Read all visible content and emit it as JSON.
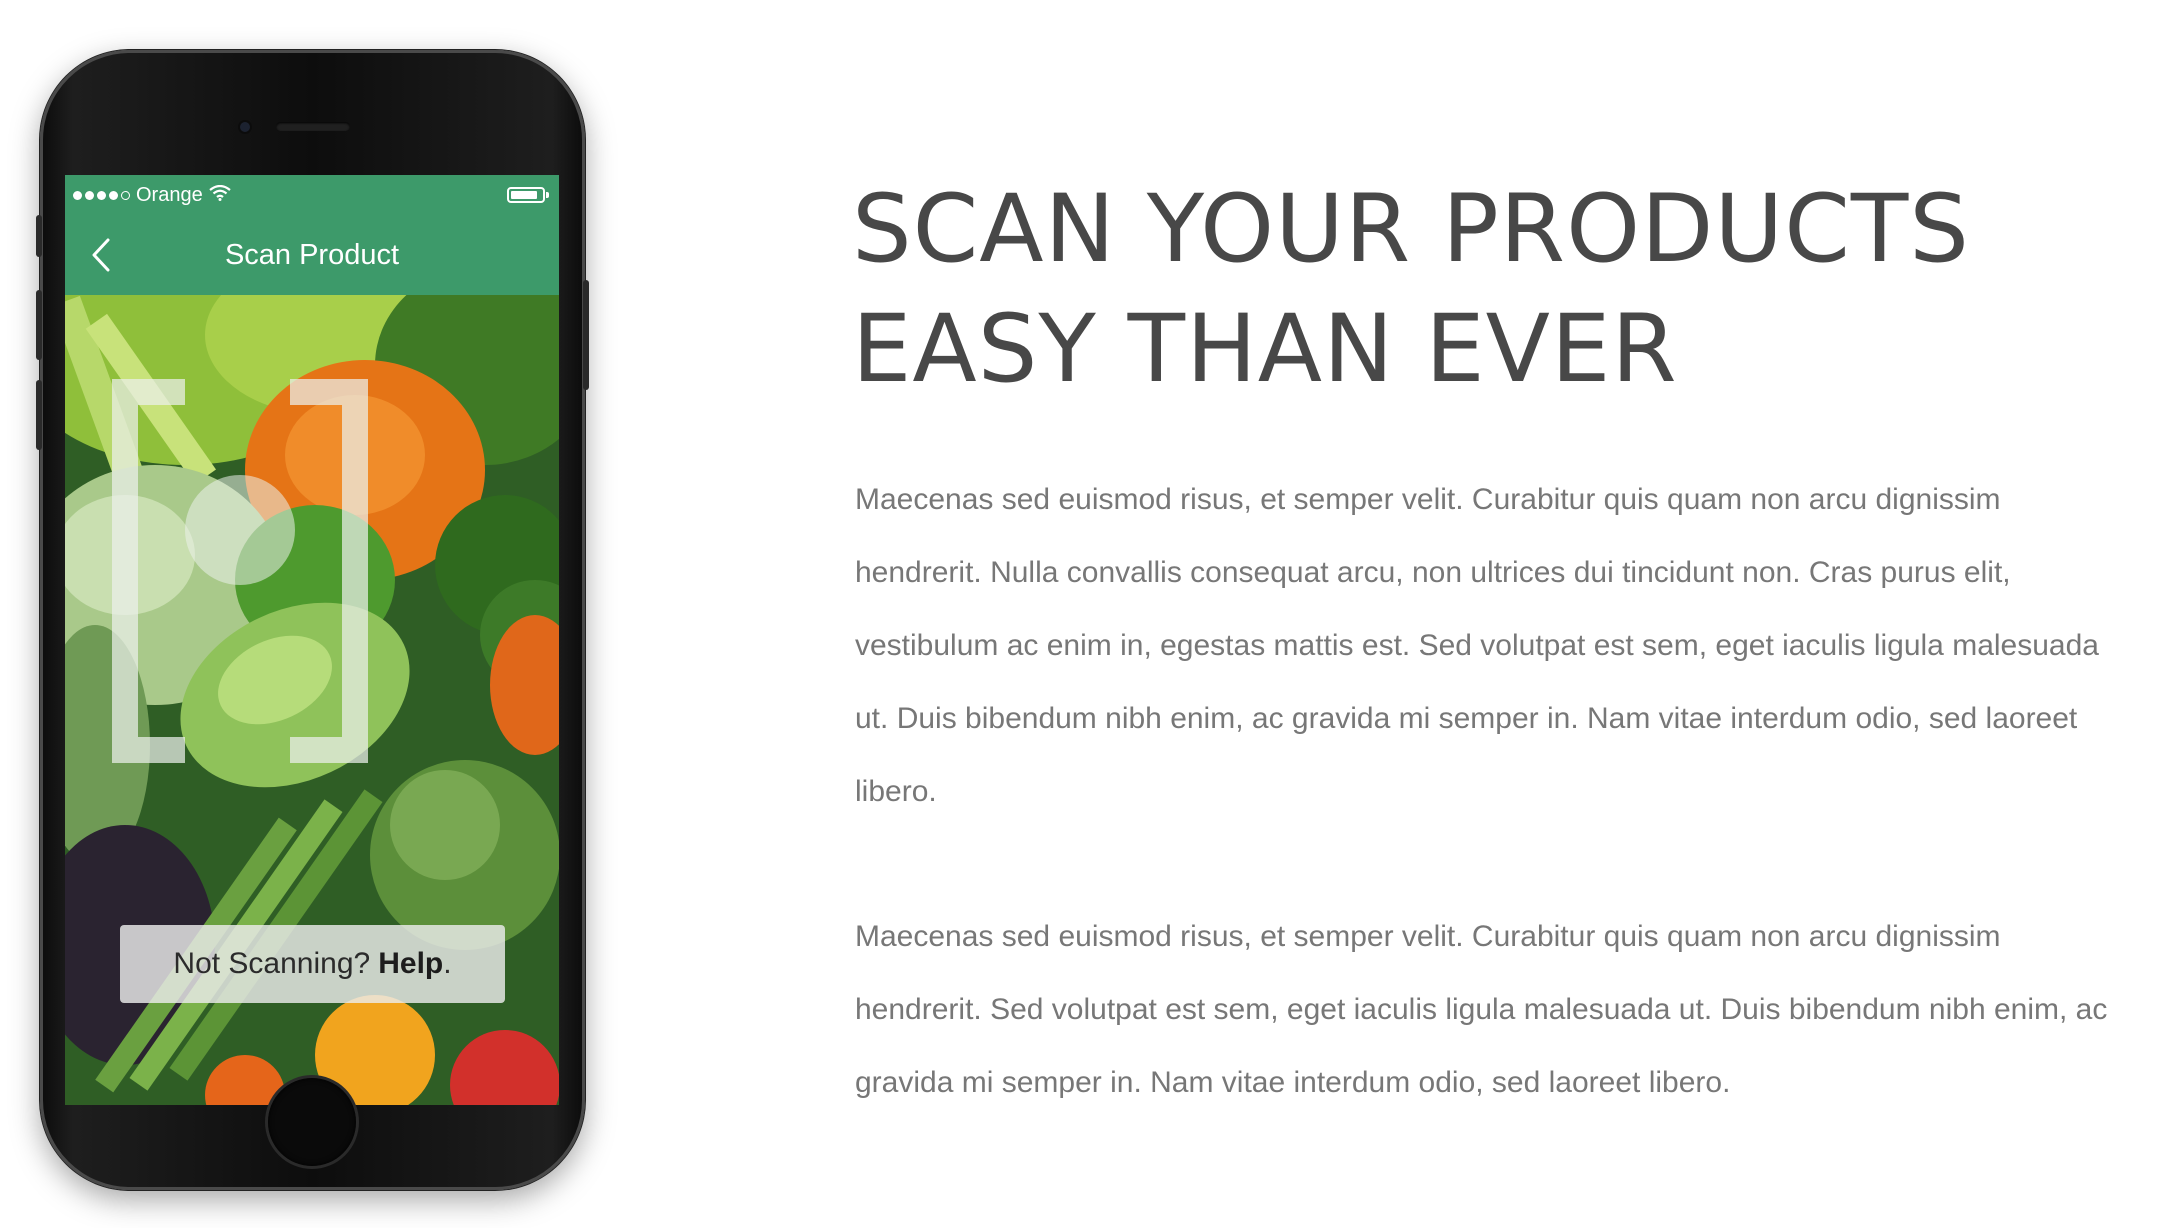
{
  "phone": {
    "status_bar": {
      "carrier": "Orange",
      "signal_bars_filled": 4,
      "signal_bars_total": 5,
      "icons": [
        "signal-dots-icon",
        "wifi-icon",
        "battery-icon"
      ]
    },
    "nav": {
      "title": "Scan Product",
      "back_icon": "chevron-left-icon"
    },
    "scanner": {
      "frame_icon": "scan-bracket-icon",
      "help_prefix": "Not Scanning?",
      "help_link": "Help",
      "help_suffix": "."
    }
  },
  "content": {
    "headline_line1": "SCAN YOUR PRODUCTS",
    "headline_line2": "EASY THAN EVER",
    "paragraph1": "Maecenas sed euismod risus, et semper velit. Curabitur quis quam non arcu dignissim hendrerit. Nulla convallis consequat arcu, non ultrices dui tincidunt non. Cras purus elit, vestibulum ac enim in, egestas mattis est. Sed volutpat est sem, eget iaculis ligula malesuada ut. Duis bibendum nibh enim, ac gravida mi semper in. Nam vitae interdum odio, sed laoreet libero.",
    "paragraph2": "Maecenas sed euismod risus, et semper velit. Curabitur quis quam non arcu dignissim hendrerit. Sed volutpat est sem, eget iaculis ligula malesuada ut. Duis bibendum nibh enim, ac gravida mi semper in. Nam vitae interdum odio, sed laoreet libero."
  },
  "colors": {
    "app_bar": "#3d9a6a",
    "headline": "#484848",
    "body_text": "#777777"
  }
}
